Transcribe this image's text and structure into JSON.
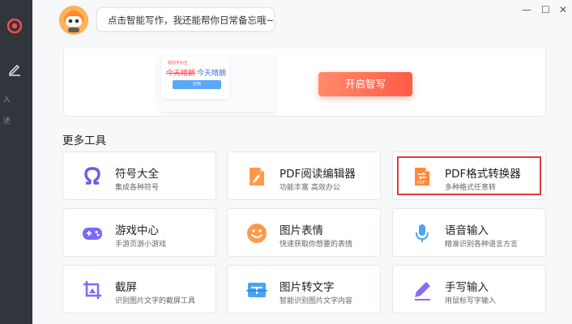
{
  "sidebar": {
    "truncated_label_1": "入",
    "truncated_label_2": "述"
  },
  "header": {
    "speech": "点击智能写作，我还能帮你日常备忘哦~",
    "win_minimize": "—",
    "win_maximize": "☐",
    "win_close": "✕"
  },
  "banner": {
    "mock_tag": "错别字纠正",
    "mock_old": "今天晴朗",
    "mock_new": "今天晴朗",
    "mock_button": "应用",
    "start_button": "开启智写"
  },
  "tools": {
    "section_title": "更多工具",
    "items": [
      {
        "title": "符号大全",
        "sub": "集成各种符号",
        "icon": "omega-icon"
      },
      {
        "title": "PDF阅读编辑器",
        "sub": "功能丰富 高效办公",
        "icon": "pdf-edit-icon"
      },
      {
        "title": "PDF格式转换器",
        "sub": "多种格式任意转",
        "icon": "pdf-convert-icon"
      },
      {
        "title": "游戏中心",
        "sub": "手游页游小游戏",
        "icon": "gamepad-icon"
      },
      {
        "title": "图片表情",
        "sub": "快速获取你想要的表情",
        "icon": "smiley-icon"
      },
      {
        "title": "语音输入",
        "sub": "精准识别各种语言方言",
        "icon": "microphone-icon"
      },
      {
        "title": "截屏",
        "sub": "识别图片文字的截屏工具",
        "icon": "screenshot-icon"
      },
      {
        "title": "图片转文字",
        "sub": "智能识别图片文字内容",
        "icon": "image-to-text-icon"
      },
      {
        "title": "手写输入",
        "sub": "用鼠标写字输入",
        "icon": "pen-icon"
      }
    ]
  },
  "colors": {
    "accent": "#ff6a4d",
    "sidebar": "#31363d",
    "highlight": "#e23a3a"
  }
}
